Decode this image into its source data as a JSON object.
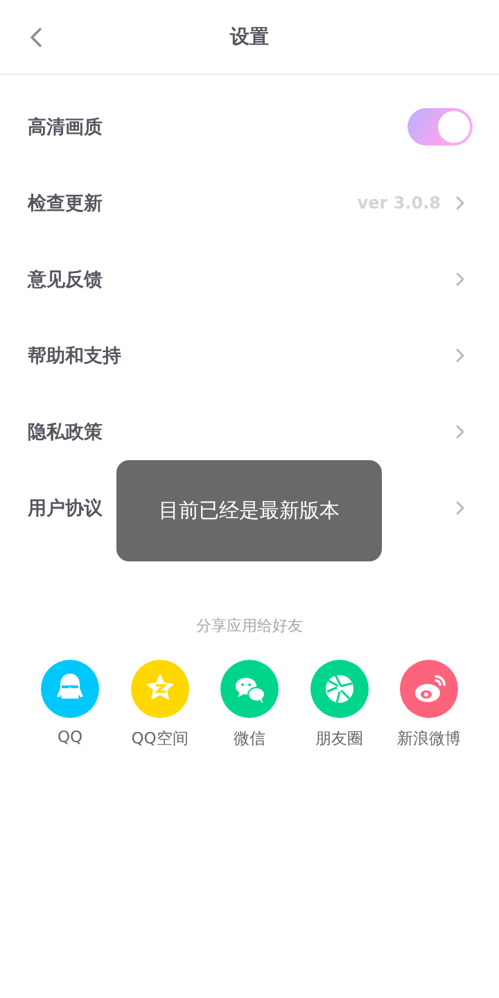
{
  "header": {
    "title": "设置"
  },
  "settings": [
    {
      "kind": "toggle",
      "label": "高清画质",
      "on": true
    },
    {
      "kind": "link",
      "label": "检查更新",
      "value": "ver 3.0.8"
    },
    {
      "kind": "link",
      "label": "意见反馈"
    },
    {
      "kind": "link",
      "label": "帮助和支持"
    },
    {
      "kind": "link",
      "label": "隐私政策"
    },
    {
      "kind": "link",
      "label": "用户协议"
    }
  ],
  "toast": {
    "message": "目前已经是最新版本"
  },
  "share": {
    "title": "分享应用给好友",
    "targets": [
      {
        "kind": "qq",
        "label": "QQ",
        "color": "#00c8fc"
      },
      {
        "kind": "qzone",
        "label": "QQ空间",
        "color": "#ffd800"
      },
      {
        "kind": "wechat",
        "label": "微信",
        "color": "#00d68b"
      },
      {
        "kind": "moments",
        "label": "朋友圈",
        "color": "#00d68b"
      },
      {
        "kind": "weibo",
        "label": "新浪微博",
        "color": "#fe637c"
      }
    ]
  }
}
